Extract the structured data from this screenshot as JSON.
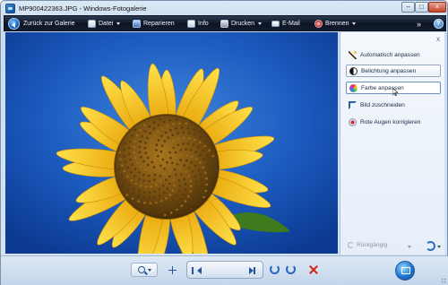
{
  "window": {
    "title": "MP900422363.JPG - Windows-Fotogalerie"
  },
  "toolbar": {
    "back_label": "Zurück zur Galerie",
    "file_label": "Datei",
    "repair_label": "Reparieren",
    "info_label": "Info",
    "print_label": "Drucken",
    "email_label": "E-Mail",
    "burn_label": "Brennen",
    "more_glyph": "»",
    "help_glyph": "?"
  },
  "fix_panel": {
    "close_glyph": "x",
    "items": [
      {
        "label": "Automatisch anpassen",
        "icon": "magic-wand-icon"
      },
      {
        "label": "Belichtung anpassen",
        "icon": "exposure-icon"
      },
      {
        "label": "Farbe anpassen",
        "icon": "color-wheel-icon"
      },
      {
        "label": "Bild zuschneiden",
        "icon": "crop-icon"
      },
      {
        "label": "Rote Augen korrigieren",
        "icon": "red-eye-icon"
      }
    ],
    "undo_label": "Rückgängig"
  },
  "photo": {
    "subject": "sunflower"
  },
  "colors": {
    "toolbar_bg": "#0c1424",
    "sky_blue": "#1c5bbf",
    "petal_yellow": "#f7c81a",
    "center_brown": "#6b4612",
    "delete_red": "#d0281e"
  }
}
